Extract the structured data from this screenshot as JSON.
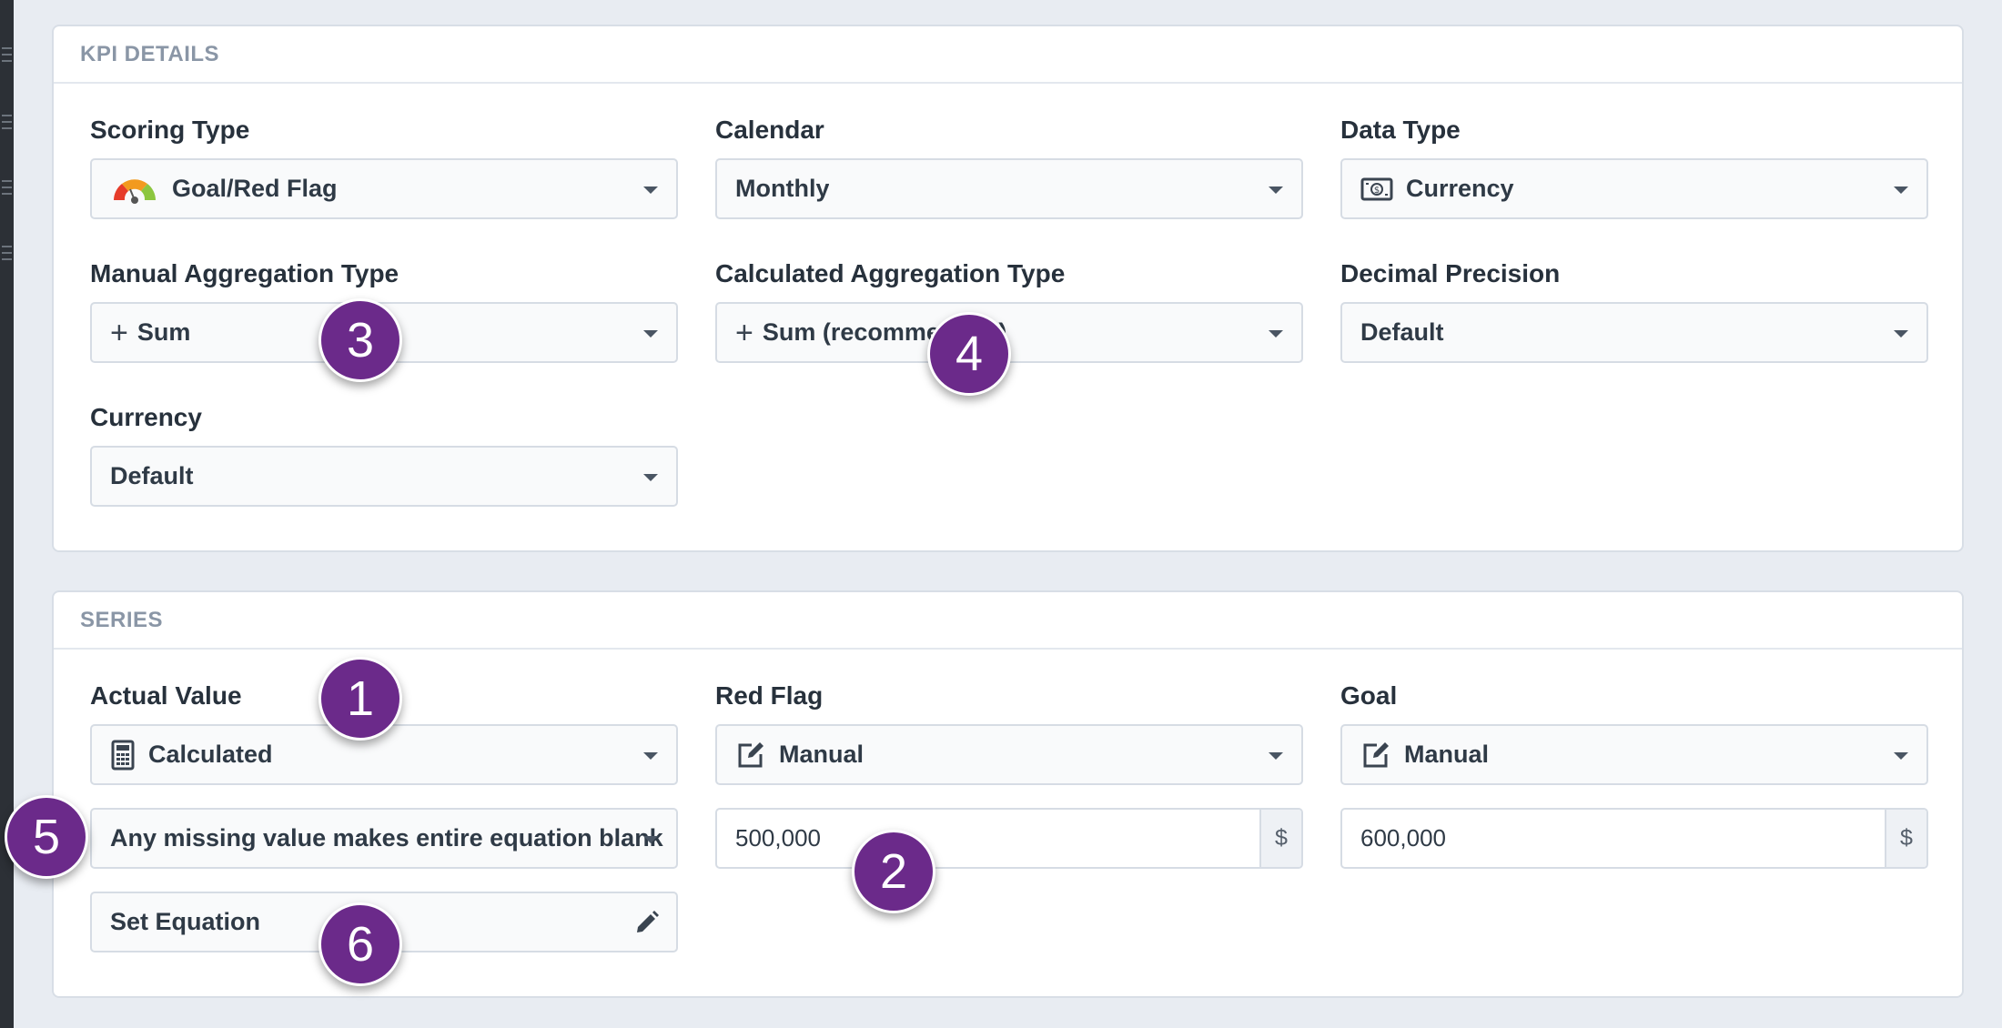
{
  "kpi_details": {
    "title": "KPI DETAILS",
    "scoring_type": {
      "label": "Scoring Type",
      "value": "Goal/Red Flag",
      "icon": "gauge-icon"
    },
    "calendar": {
      "label": "Calendar",
      "value": "Monthly"
    },
    "data_type": {
      "label": "Data Type",
      "value": "Currency",
      "icon": "currency-icon"
    },
    "manual_aggregation": {
      "label": "Manual Aggregation Type",
      "value": "Sum",
      "icon": "plus-icon"
    },
    "calculated_aggregation": {
      "label": "Calculated Aggregation Type",
      "value": "Sum (recommended)",
      "icon": "plus-icon"
    },
    "decimal_precision": {
      "label": "Decimal Precision",
      "value": "Default"
    },
    "currency": {
      "label": "Currency",
      "value": "Default"
    }
  },
  "series": {
    "title": "SERIES",
    "actual_value": {
      "label": "Actual Value",
      "value": "Calculated",
      "icon": "calculator-icon"
    },
    "red_flag": {
      "label": "Red Flag",
      "value": "Manual",
      "icon": "edit-icon",
      "input_value": "500,000",
      "addon": "$"
    },
    "goal": {
      "label": "Goal",
      "value": "Manual",
      "icon": "edit-icon",
      "input_value": "600,000",
      "addon": "$"
    },
    "missing_value_option": {
      "value": "Any missing value makes entire equation blank"
    },
    "set_equation": {
      "label": "Set Equation",
      "icon": "pencil-icon"
    }
  },
  "annotations": [
    "1",
    "2",
    "3",
    "4",
    "5",
    "6"
  ],
  "colors": {
    "badge": "#6b2a8a",
    "gauge_red": "#e63c2a",
    "gauge_orange": "#f29a1f",
    "gauge_green": "#8cc63f",
    "background": "#e8ecf2"
  }
}
